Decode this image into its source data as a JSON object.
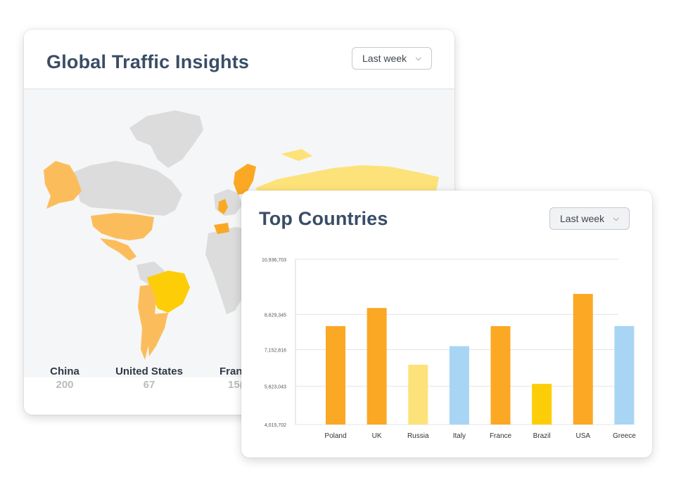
{
  "global_card": {
    "title": "Global Traffic Insights",
    "dropdown": "Last week",
    "stats": [
      {
        "country": "China",
        "value": "200"
      },
      {
        "country": "United States",
        "value": "67"
      },
      {
        "country": "Fran",
        "value": "15("
      }
    ]
  },
  "top_card": {
    "title": "Top Countries",
    "dropdown": "Last week"
  },
  "colors": {
    "orange": "#fba824",
    "light_yellow": "#fde27a",
    "yellow": "#fdcd07",
    "light_blue": "#a8d5f3",
    "title": "#3a4d66"
  },
  "chart_data": {
    "type": "bar",
    "categories": [
      "Poland",
      "UK",
      "Russia",
      "Italy",
      "France",
      "Brazil",
      "USA",
      "Greece"
    ],
    "values": [
      8140000,
      8900000,
      6520000,
      7300000,
      8140000,
      5720000,
      9490000,
      8140000
    ],
    "bar_colors": [
      "orange",
      "orange",
      "light_yellow",
      "light_blue",
      "orange",
      "yellow",
      "orange",
      "light_blue"
    ],
    "y_ticks": [
      "4,015,702",
      "5,623,043",
      "7,152,816",
      "8,629,345",
      "10,936,703"
    ],
    "ylim": [
      4015702,
      10936703
    ],
    "grid": true
  }
}
